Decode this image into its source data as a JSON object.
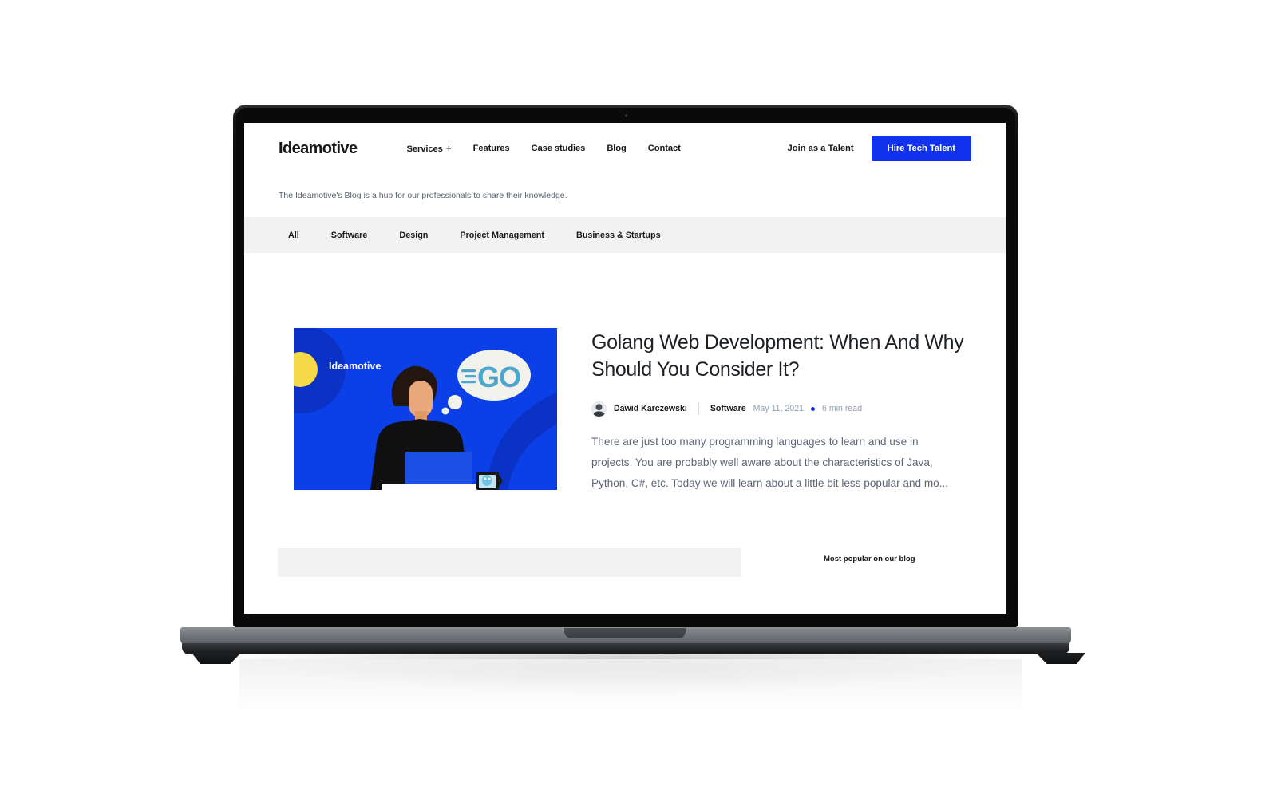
{
  "brand": {
    "logo_text": "Ideamotive",
    "accent_color": "#1133ee",
    "text_color": "#17181a"
  },
  "header": {
    "nav": [
      {
        "label": "Services",
        "has_plus": true,
        "plus": "+"
      },
      {
        "label": "Features",
        "has_plus": false
      },
      {
        "label": "Case studies",
        "has_plus": false
      },
      {
        "label": "Blog",
        "has_plus": false
      },
      {
        "label": "Contact",
        "has_plus": false
      }
    ],
    "talent_link": "Join as a Talent",
    "cta_button": "Hire Tech Talent"
  },
  "tagline": "The Ideamotive's Blog is a hub for our professionals to share their knowledge.",
  "categories": [
    {
      "label": "All",
      "active": true
    },
    {
      "label": "Software",
      "active": false
    },
    {
      "label": "Design",
      "active": false
    },
    {
      "label": "Project Management",
      "active": false
    },
    {
      "label": "Business & Startups",
      "active": false
    }
  ],
  "featured_post": {
    "thumbnail": {
      "brand_watermark": "Ideamotive",
      "bubble_text": "GO",
      "bg_color": "#0b3fe8",
      "accent_yellow": "#f5d949",
      "go_color": "#4ea6cd",
      "bubble_color": "#f1f2ec"
    },
    "title": "Golang Web Development: When And Why Should You Consider It?",
    "author": "Dawid Karczewski",
    "category": "Software",
    "date": "May 11, 2021",
    "read_time": "6 min read",
    "excerpt": "There are just too many programming languages to learn and use in projects. You are probably well aware about the characteristics of Java, Python, C#, etc. Today we will learn about a little bit less popular and mo..."
  },
  "sidebar": {
    "popular_heading": "Most popular on our blog"
  }
}
